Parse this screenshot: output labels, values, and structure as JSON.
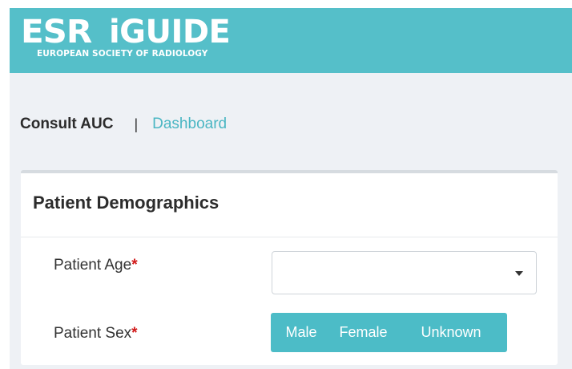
{
  "header": {
    "logo_mark": "ESR",
    "product": "iGUIDE",
    "org": "EUROPEAN SOCIETY OF RADIOLOGY",
    "background": "#55bfc9"
  },
  "nav": {
    "current": "Consult AUC",
    "separator": "|",
    "link": "Dashboard"
  },
  "demographics": {
    "title": "Patient Demographics",
    "age": {
      "label": "Patient Age",
      "required_mark": "*",
      "value": "",
      "icon": "chevron-down-icon"
    },
    "sex": {
      "label": "Patient Sex",
      "required_mark": "*",
      "options": [
        "Male",
        "Female",
        "Unknown"
      ],
      "selected": null
    }
  },
  "colors": {
    "accent": "#4cbcc7",
    "required": "#d11a1a",
    "link": "#4ab6c3"
  }
}
